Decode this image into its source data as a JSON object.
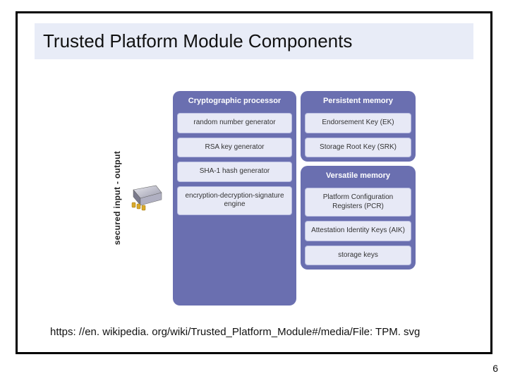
{
  "title": "Trusted Platform Module Components",
  "io_label": "secured input - output",
  "chip_icon_name": "tpm-chip-icon",
  "columns": {
    "crypto": {
      "header": "Cryptographic processor",
      "cells": [
        "random number generator",
        "RSA key generator",
        "SHA-1 hash generator",
        "encryption-decryption-signature engine"
      ]
    },
    "persistent": {
      "header": "Persistent memory",
      "cells": [
        "Endorsement Key (EK)",
        "Storage Root Key (SRK)"
      ]
    },
    "versatile": {
      "header": "Versatile memory",
      "cells": [
        "Platform Configuration Registers (PCR)",
        "Attestation Identity Keys (AIK)",
        "storage keys"
      ]
    }
  },
  "source_url": "https: //en. wikipedia. org/wiki/Trusted_Platform_Module#/media/File: TPM. svg",
  "page_number": "6"
}
